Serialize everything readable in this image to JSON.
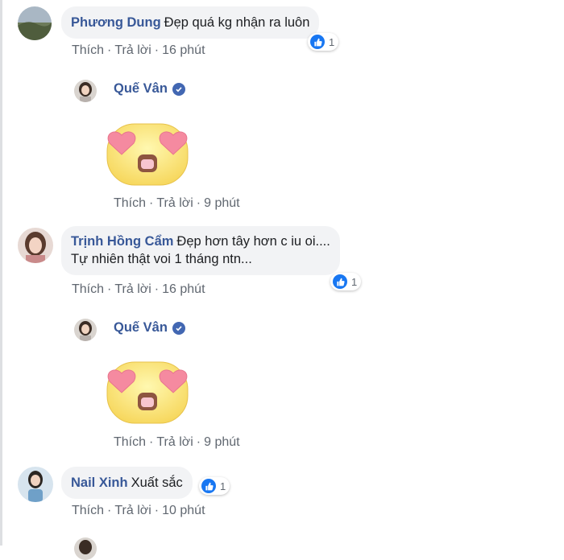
{
  "actions": {
    "like": "Thích",
    "reply": "Trả lời",
    "separator": "·"
  },
  "comments": [
    {
      "author": "Phương Dung",
      "text": "Đẹp quá kg nhận ra luôn",
      "time": "16 phút",
      "likes": "1"
    },
    {
      "author": "Trịnh Hồng Cẩm",
      "text_line1": "Đẹp hơn tây hơn c iu oi....",
      "text_line2": "Tự nhiên thật voi 1 tháng ntn...",
      "time": "16 phút",
      "likes": "1"
    },
    {
      "author": "Nail Xinh",
      "text": "Xuất sắc",
      "time": "10 phút",
      "likes": "1"
    }
  ],
  "replies": [
    {
      "author": "Quế Vân",
      "sticker": "heart-eyes-sticker",
      "time": "9 phút"
    },
    {
      "author": "Quế Vân",
      "sticker": "heart-eyes-sticker",
      "time": "9 phút"
    }
  ],
  "colors": {
    "link": "#385898",
    "bubble": "#f2f3f5",
    "like": "#1877f2",
    "meta": "#606770"
  }
}
